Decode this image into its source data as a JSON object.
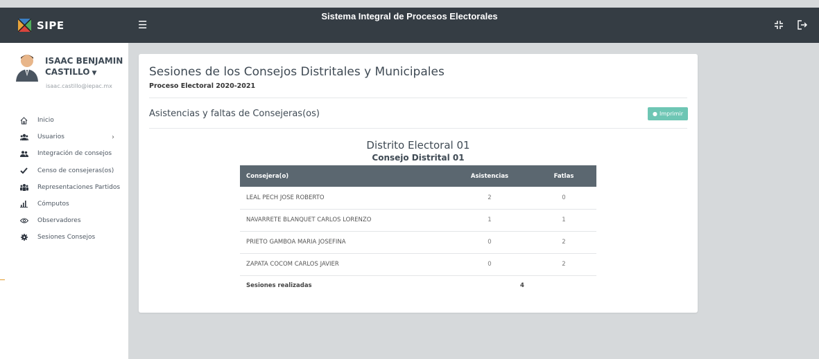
{
  "app": {
    "brand": "SIPE",
    "system_title": "Sistema Integral de Procesos Electorales"
  },
  "user": {
    "name": "ISAAC BENJAMIN CASTILLO",
    "email": "isaac.castillo@iepac.mx"
  },
  "menu": [
    {
      "label": "Inicio",
      "icon": "home-icon"
    },
    {
      "label": "Usuarios",
      "icon": "users-icon",
      "has_submenu": true
    },
    {
      "label": "Integración de consejos",
      "icon": "group-icon"
    },
    {
      "label": "Censo de consejeras(os)",
      "icon": "check-icon"
    },
    {
      "label": "Representaciones Partidos",
      "icon": "party-icon"
    },
    {
      "label": "Cómputos",
      "icon": "bar-chart-icon"
    },
    {
      "label": "Observadores",
      "icon": "eye-icon"
    },
    {
      "label": "Sesiones Consejos",
      "icon": "gear-icon"
    }
  ],
  "page": {
    "title": "Sesiones de los Consejos Distritales y Municipales",
    "subtitle": "Proceso Electoral 2020-2021",
    "section_title": "Asistencias y faltas de Consejeras(os)",
    "print_label": "Imprimir",
    "district": "Distrito Electoral 01",
    "council": "Consejo Distrital 01"
  },
  "table": {
    "headers": [
      "Consejera(o)",
      "Asistencias",
      "Fatlas"
    ],
    "rows": [
      [
        "LEAL PECH JOSE ROBERTO",
        "2",
        "0"
      ],
      [
        "NAVARRETE BLANQUET CARLOS LORENZO",
        "1",
        "1"
      ],
      [
        "PRIETO GAMBOA MARIA JOSEFINA",
        "0",
        "2"
      ],
      [
        "ZAPATA COCOM CARLOS JAVIER",
        "0",
        "2"
      ]
    ],
    "total_label": "Sesiones realizadas",
    "total_value": "4"
  },
  "colors": {
    "topbar": "#353d44",
    "table_header": "#5b6770",
    "print_button": "#6ec6b4",
    "background": "#d6d9db"
  }
}
